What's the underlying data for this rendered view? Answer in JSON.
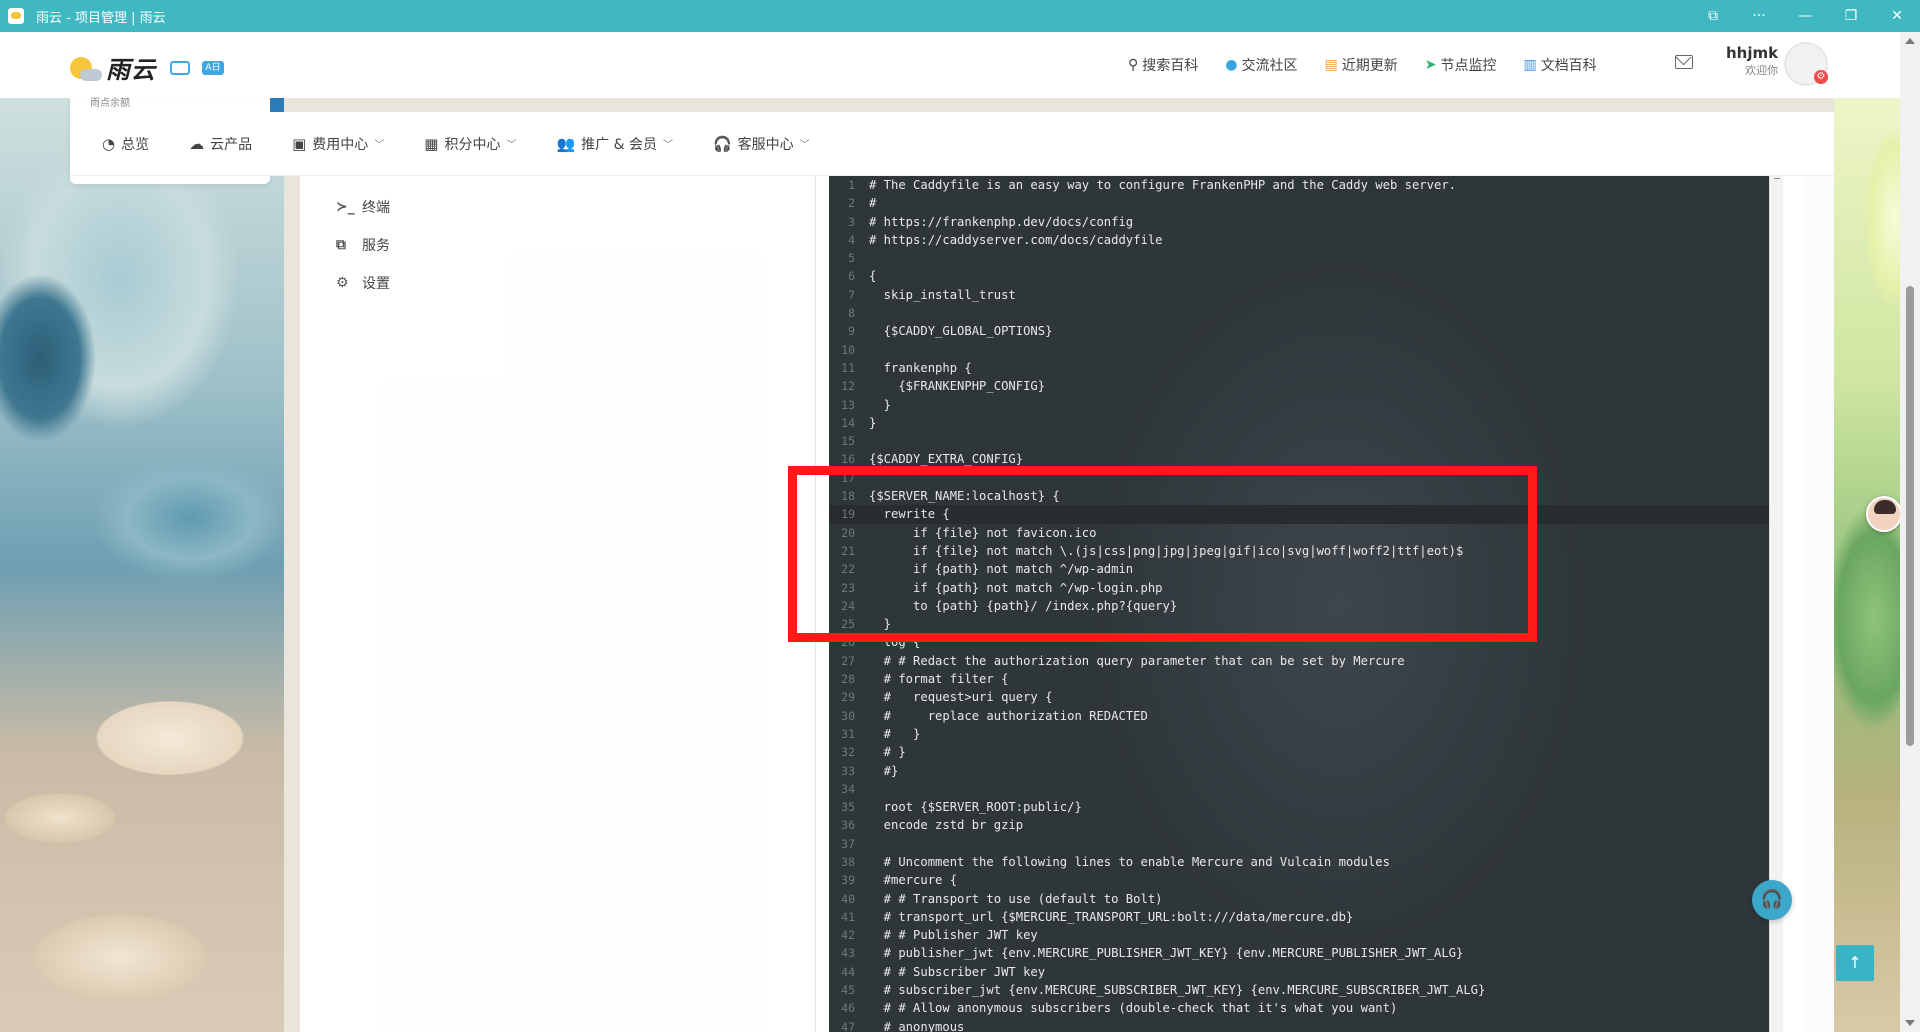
{
  "window": {
    "title": "雨云 - 项目管理 | 雨云",
    "controls": [
      "⧉",
      "···",
      "—",
      "❐",
      "✕"
    ]
  },
  "header": {
    "logo_text": "雨云",
    "logo_badge": "A日",
    "nav": [
      {
        "icon": "search-icon",
        "glyph": "⚲",
        "label": "搜索百科"
      },
      {
        "icon": "community-icon",
        "glyph": "●",
        "label": "交流社区"
      },
      {
        "icon": "updates-icon",
        "glyph": "▤",
        "label": "近期更新"
      },
      {
        "icon": "monitor-icon",
        "glyph": "➤",
        "label": "节点监控"
      },
      {
        "icon": "docs-icon",
        "glyph": "▥",
        "label": "文档百科"
      }
    ],
    "user": {
      "name": "hhjmk",
      "welcome": "欢迎你"
    },
    "cut_text": "雨点余额"
  },
  "subnav": [
    {
      "icon": "dashboard-icon",
      "glyph": "◔",
      "label": "总览",
      "dropdown": false
    },
    {
      "icon": "cloud-product-icon",
      "glyph": "☁",
      "label": "云产品",
      "dropdown": false
    },
    {
      "icon": "billing-icon",
      "glyph": "▣",
      "label": "费用中心",
      "dropdown": true
    },
    {
      "icon": "points-icon",
      "glyph": "▦",
      "label": "积分中心",
      "dropdown": true
    },
    {
      "icon": "promo-icon",
      "glyph": "👥",
      "label": "推广 & 会员",
      "dropdown": true
    },
    {
      "icon": "support-icon",
      "glyph": "🎧",
      "label": "客服中心",
      "dropdown": true
    }
  ],
  "sidemenu": [
    {
      "icon": "terminal-icon",
      "glyph": "≻_",
      "label": "终端"
    },
    {
      "icon": "services-icon",
      "glyph": "⧉",
      "label": "服务"
    },
    {
      "icon": "settings-icon",
      "glyph": "⚙",
      "label": "设置"
    }
  ],
  "editor": {
    "active_line": 19,
    "lines": [
      "# The Caddyfile is an easy way to configure FrankenPHP and the Caddy web server.",
      "#",
      "# https://frankenphp.dev/docs/config",
      "# https://caddyserver.com/docs/caddyfile",
      "",
      "{",
      "  skip_install_trust",
      "",
      "  {$CADDY_GLOBAL_OPTIONS}",
      "",
      "  frankenphp {",
      "    {$FRANKENPHP_CONFIG}",
      "  }",
      "}",
      "",
      "{$CADDY_EXTRA_CONFIG}",
      "",
      "{$SERVER_NAME:localhost} {",
      "  rewrite {",
      "      if {file} not favicon.ico",
      "      if {file} not match \\.(js|css|png|jpg|jpeg|gif|ico|svg|woff|woff2|ttf|eot)$",
      "      if {path} not match ^/wp-admin",
      "      if {path} not match ^/wp-login.php",
      "      to {path} {path}/ /index.php?{query}",
      "  }",
      "  log {",
      "  # # Redact the authorization query parameter that can be set by Mercure",
      "  # format filter {",
      "  #   request>uri query {",
      "  #     replace authorization REDACTED",
      "  #   }",
      "  # }",
      "  #}",
      "",
      "  root {$SERVER_ROOT:public/}",
      "  encode zstd br gzip",
      "",
      "  # Uncomment the following lines to enable Mercure and Vulcain modules",
      "  #mercure {",
      "  # # Transport to use (default to Bolt)",
      "  # transport_url {$MERCURE_TRANSPORT_URL:bolt:///data/mercure.db}",
      "  # # Publisher JWT key",
      "  # publisher_jwt {env.MERCURE_PUBLISHER_JWT_KEY} {env.MERCURE_PUBLISHER_JWT_ALG}",
      "  # # Subscriber JWT key",
      "  # subscriber_jwt {env.MERCURE_SUBSCRIBER_JWT_KEY} {env.MERCURE_SUBSCRIBER_JWT_ALG}",
      "  # # Allow anonymous subscribers (double-check that it's what you want)",
      "  # anonymous"
    ]
  },
  "colors": {
    "titlebar": "#3fb8c2",
    "editor_bg": "#2f363a",
    "highlight": "#ff1a1a"
  },
  "floating": {
    "support_glyph": "🎧",
    "totop_glyph": "↑"
  }
}
